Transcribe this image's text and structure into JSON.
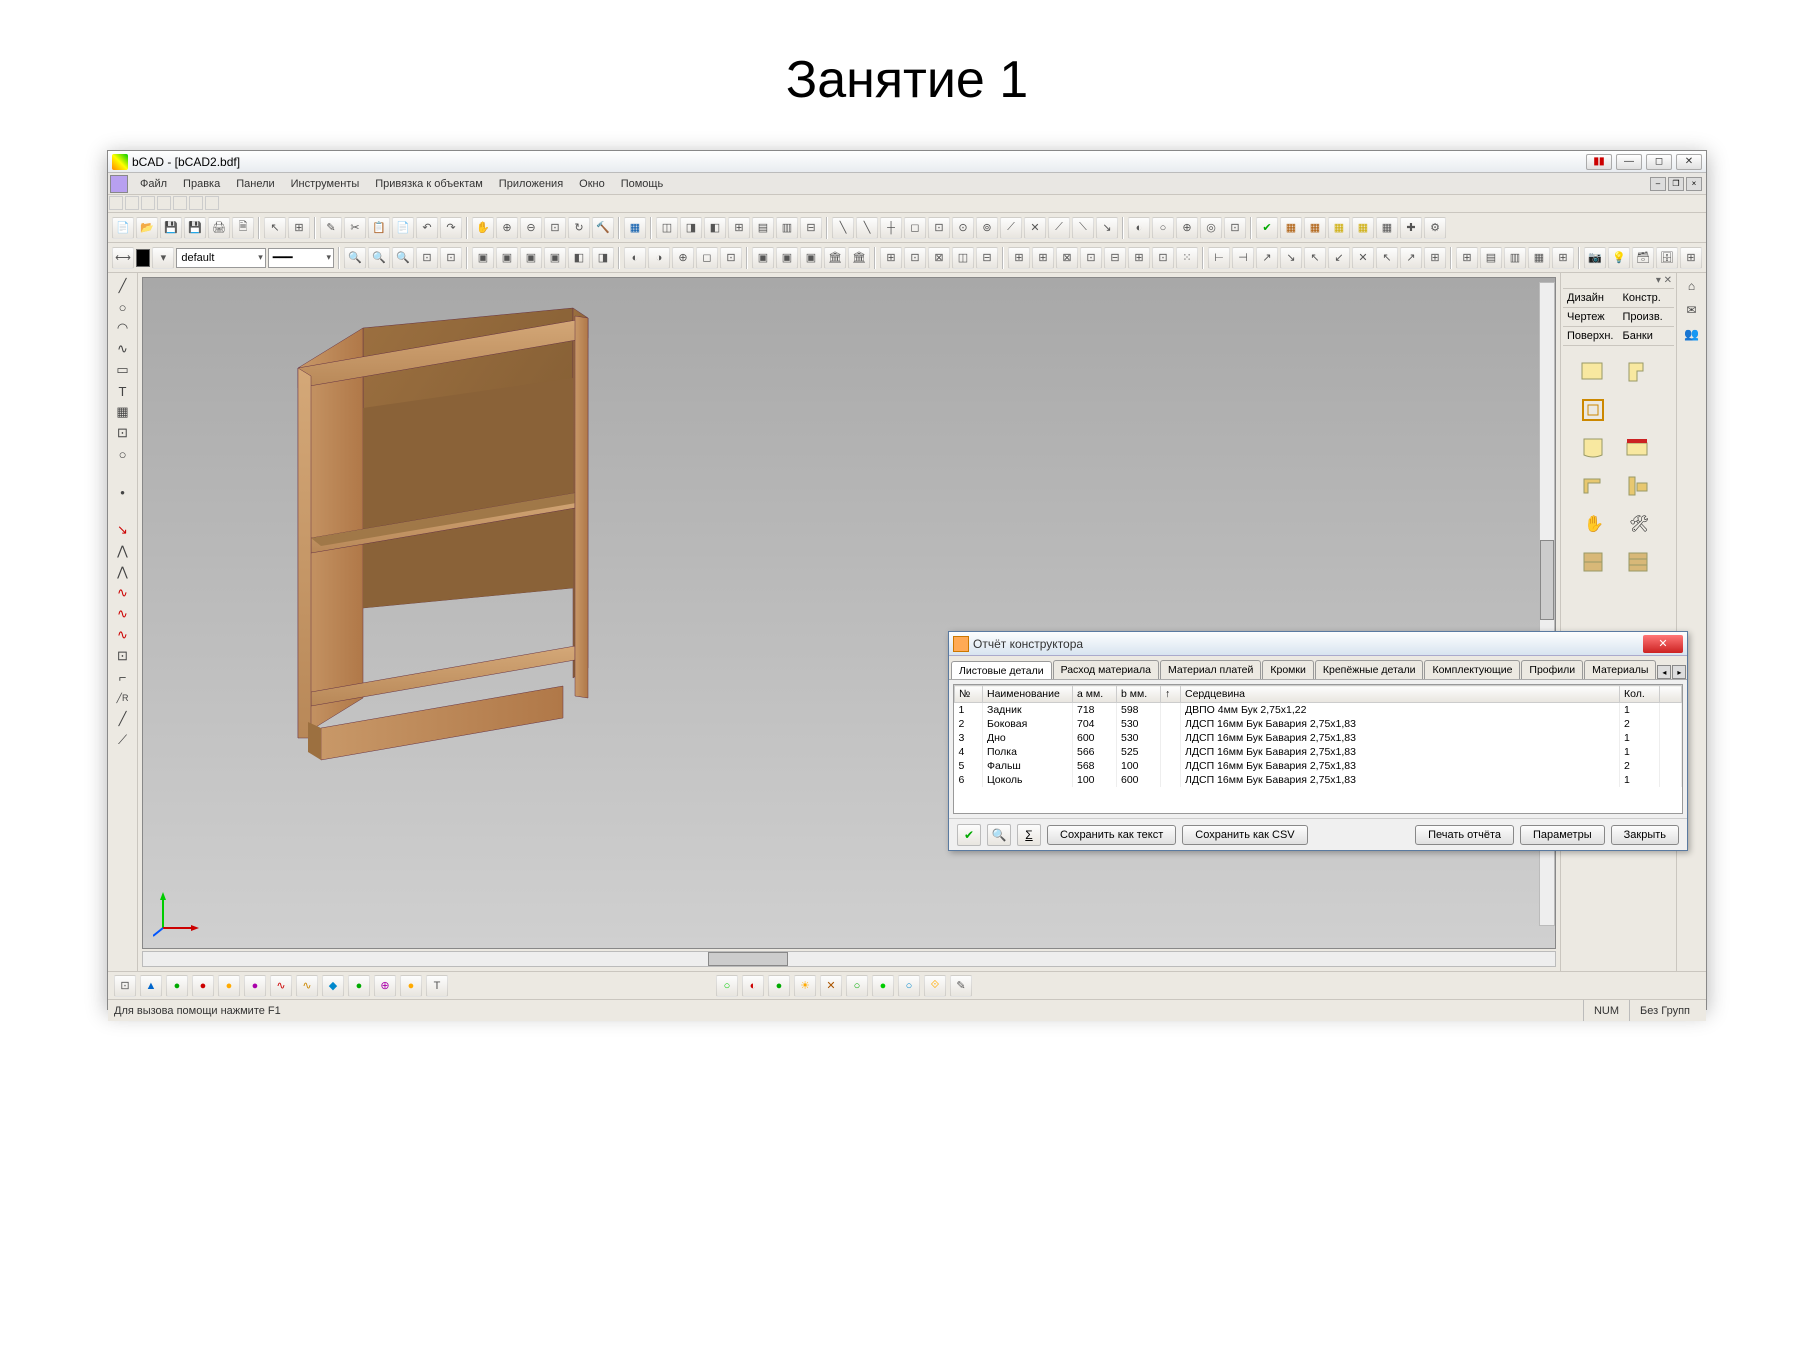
{
  "page_title": "Занятие 1",
  "app": {
    "title": "bCAD - [bCAD2.bdf]",
    "menu": [
      "Файл",
      "Правка",
      "Панели",
      "Инструменты",
      "Привязка к объектам",
      "Приложения",
      "Окно",
      "Помощь"
    ],
    "status_hint": "Для вызова помощи нажмите F1",
    "status_num": "NUM",
    "status_group": "Без Групп"
  },
  "right_panel": {
    "tabs": [
      "Дизайн",
      "Констр.",
      "Чертеж",
      "Произв.",
      "Поверхн.",
      "Банки"
    ]
  },
  "combo": {
    "layer": "default"
  },
  "dialog": {
    "title": "Отчёт конструктора",
    "tabs": [
      "Листовые детали",
      "Расход материала",
      "Материал платей",
      "Кромки",
      "Крепёжные детали",
      "Комплектующие",
      "Профили",
      "Материалы"
    ],
    "headers": [
      "№",
      "Наименование",
      "a мм.",
      "b мм.",
      "↑",
      "Сердцевина",
      "Кол."
    ],
    "rows": [
      {
        "n": "1",
        "name": "Задник",
        "a": "718",
        "b": "598",
        "core": "ДВПО 4мм Бук 2,75x1,22",
        "qty": "1"
      },
      {
        "n": "2",
        "name": "Боковая",
        "a": "704",
        "b": "530",
        "core": "ЛДСП 16мм Бук Бавария 2,75x1,83",
        "qty": "2"
      },
      {
        "n": "3",
        "name": "Дно",
        "a": "600",
        "b": "530",
        "core": "ЛДСП 16мм Бук Бавария 2,75x1,83",
        "qty": "1"
      },
      {
        "n": "4",
        "name": "Полка",
        "a": "566",
        "b": "525",
        "core": "ЛДСП 16мм Бук Бавария 2,75x1,83",
        "qty": "1"
      },
      {
        "n": "5",
        "name": "Фальш",
        "a": "568",
        "b": "100",
        "core": "ЛДСП 16мм Бук Бавария 2,75x1,83",
        "qty": "2"
      },
      {
        "n": "6",
        "name": "Цоколь",
        "a": "100",
        "b": "600",
        "core": "ЛДСП 16мм Бук Бавария 2,75x1,83",
        "qty": "1"
      }
    ],
    "buttons": {
      "save_text": "Сохранить как текст",
      "save_csv": "Сохранить как CSV",
      "print": "Печать отчёта",
      "params": "Параметры",
      "close": "Закрыть"
    }
  }
}
